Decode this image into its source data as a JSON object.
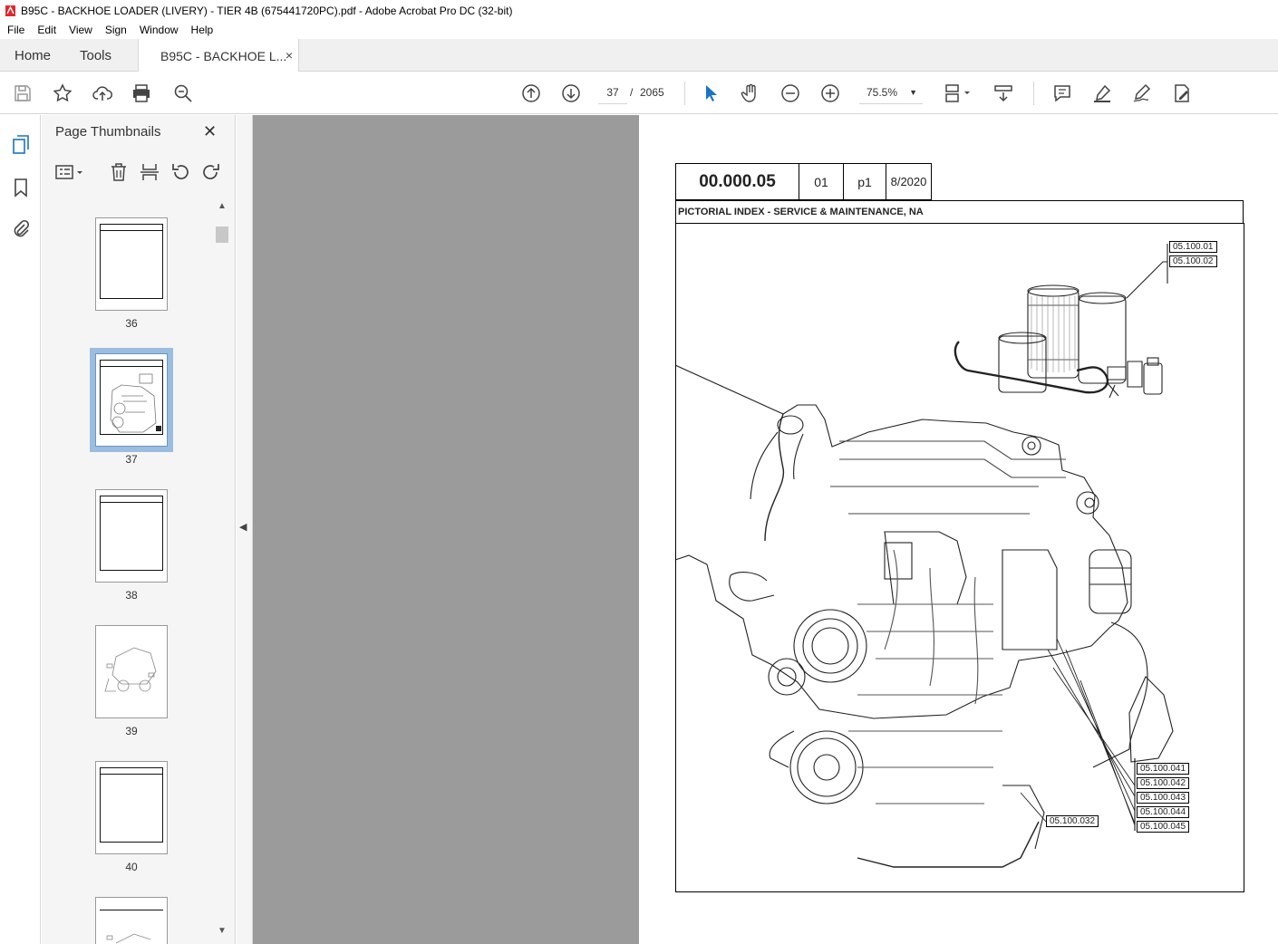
{
  "window": {
    "title": "B95C - BACKHOE LOADER (LIVERY) - TIER 4B (675441720PC).pdf - Adobe Acrobat Pro DC (32-bit)"
  },
  "menu": [
    "File",
    "Edit",
    "View",
    "Sign",
    "Window",
    "Help"
  ],
  "tabs": {
    "home": "Home",
    "tools": "Tools",
    "doc": "B95C - BACKHOE L...",
    "close": "×"
  },
  "toolbar": {
    "page_current": "37",
    "page_sep": "/",
    "page_total": "2065",
    "zoom": "75.5%"
  },
  "panel": {
    "title": "Page Thumbnails",
    "close": "✕",
    "thumbnails": [
      {
        "label": "36"
      },
      {
        "label": "37",
        "selected": true
      },
      {
        "label": "38"
      },
      {
        "label": "39"
      },
      {
        "label": "40"
      }
    ]
  },
  "document": {
    "number": "00.000.05",
    "revision": "01",
    "page": "p1",
    "date": "8/2020",
    "title": "PICTORIAL INDEX - SERVICE & MAINTENANCE, NA",
    "callouts_top": [
      "05.100.01",
      "05.100.02"
    ],
    "callouts_right": [
      "05.100.041",
      "05.100.042",
      "05.100.043",
      "05.100.044",
      "05.100.045"
    ],
    "callout_bottom": "05.100.032"
  },
  "colors": {
    "accent": "#1a73c8",
    "gray_area": "#9b9b9b",
    "selected_thumb": "#9bbdde"
  }
}
